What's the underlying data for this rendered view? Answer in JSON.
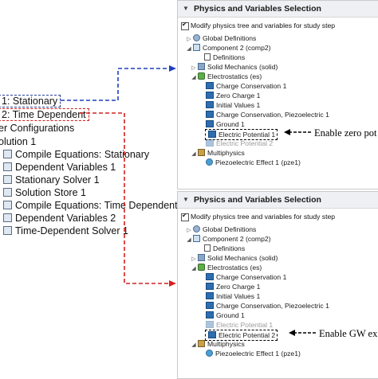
{
  "left_tree": {
    "stationary_label": "1: Stationary",
    "time_dependent_label": "2: Time Dependent",
    "rows": [
      "er Configurations",
      "olution 1",
      "Compile Equations: Stationary",
      "Dependent Variables 1",
      "Stationary Solver 1",
      "Solution Store 1",
      "Compile Equations: Time Dependent",
      "Dependent Variables 2",
      "Time-Dependent Solver 1"
    ]
  },
  "panel_top": {
    "title": "Physics and Variables Selection",
    "checkbox_label": "Modify physics tree and variables for study step",
    "tree": [
      {
        "label": "Global Definitions",
        "icon": "globe-icon"
      },
      {
        "label": "Component 2 (comp2)",
        "icon": "component-icon"
      },
      {
        "label": "Definitions",
        "icon": "definitions-icon"
      },
      {
        "label": "Solid Mechanics (solid)",
        "icon": "solid-mechanics-icon"
      },
      {
        "label": "Electrostatics (es)",
        "icon": "electrostatics-icon"
      },
      {
        "label": "Charge Conservation 1",
        "icon": "node-icon"
      },
      {
        "label": "Zero Charge 1",
        "icon": "node-icon"
      },
      {
        "label": "Initial Values 1",
        "icon": "node-icon"
      },
      {
        "label": "Charge Conservation, Piezoelectric 1",
        "icon": "node-icon"
      },
      {
        "label": "Ground 1",
        "icon": "node-icon"
      },
      {
        "label": "Electric Potential 1",
        "icon": "node-icon"
      },
      {
        "label": "Electric Potential 2",
        "icon": "node-icon"
      },
      {
        "label": "Multiphysics",
        "icon": "multiphysics-icon"
      },
      {
        "label": "Piezoelectric Effect 1 (pze1)",
        "icon": "piezoelectric-icon"
      }
    ],
    "annotation": "Enable zero pot"
  },
  "panel_bottom": {
    "title": "Physics and Variables Selection",
    "checkbox_label": "Modify physics tree and variables for study step",
    "tree": [
      {
        "label": "Global Definitions",
        "icon": "globe-icon"
      },
      {
        "label": "Component 2 (comp2)",
        "icon": "component-icon"
      },
      {
        "label": "Definitions",
        "icon": "definitions-icon"
      },
      {
        "label": "Solid Mechanics (solid)",
        "icon": "solid-mechanics-icon"
      },
      {
        "label": "Electrostatics (es)",
        "icon": "electrostatics-icon"
      },
      {
        "label": "Charge Conservation 1",
        "icon": "node-icon"
      },
      {
        "label": "Zero Charge 1",
        "icon": "node-icon"
      },
      {
        "label": "Initial Values 1",
        "icon": "node-icon"
      },
      {
        "label": "Charge Conservation, Piezoelectric 1",
        "icon": "node-icon"
      },
      {
        "label": "Ground 1",
        "icon": "node-icon"
      },
      {
        "label": "Electric Potential 1",
        "icon": "node-icon"
      },
      {
        "label": "Electric Potential 2",
        "icon": "node-icon"
      },
      {
        "label": "Multiphysics",
        "icon": "multiphysics-icon"
      },
      {
        "label": "Piezoelectric Effect 1 (pze1)",
        "icon": "piezoelectric-icon"
      }
    ],
    "annotation": "Enable GW ex"
  },
  "colors": {
    "blue_arrow": "#1f3fbf",
    "red_arrow": "#d42020",
    "panel_header": "#eef0f3"
  }
}
